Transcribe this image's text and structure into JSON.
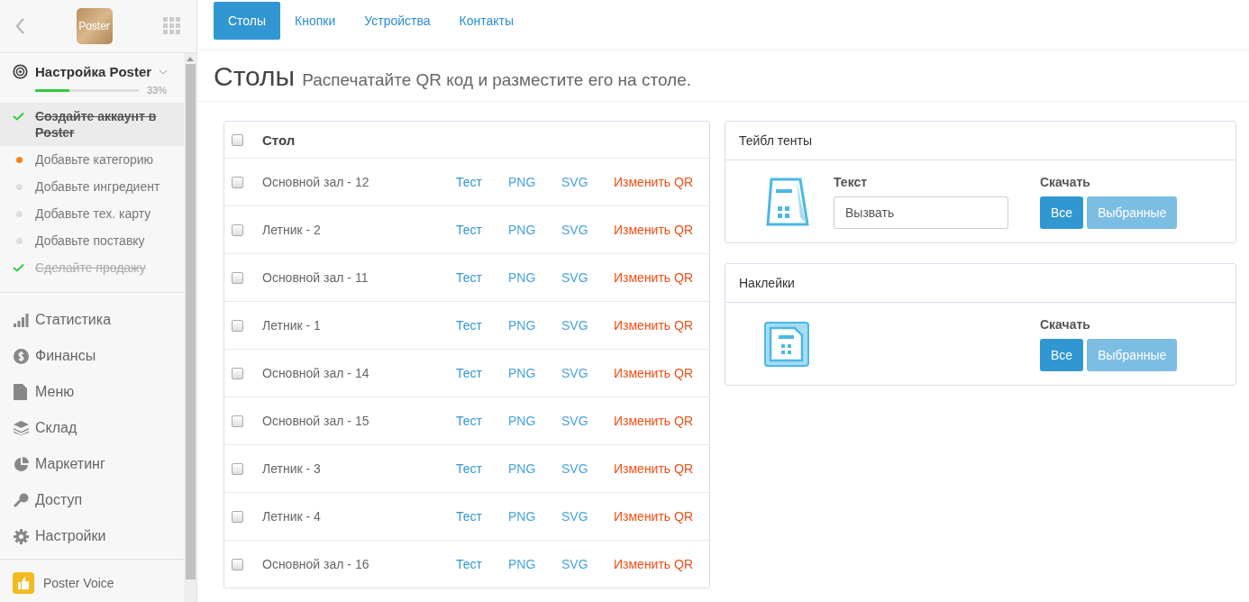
{
  "sidebar": {
    "logo_text": "Poster",
    "setup": {
      "title": "Настройка Poster",
      "level": 0.33,
      "percent": "33%",
      "steps": [
        {
          "label": "Создайте аккаунт в Poster",
          "done": true,
          "selected": true
        },
        {
          "label": "Добавьте категорию",
          "done": false,
          "current": true,
          "selected": false
        },
        {
          "label": "Добавьте ингредиент",
          "done": false,
          "current": false,
          "selected": false
        },
        {
          "label": "Добавьте тех. карту",
          "done": false,
          "current": false,
          "selected": false
        },
        {
          "label": "Добавьте поставку",
          "done": false,
          "current": false,
          "selected": false
        },
        {
          "label": "Сделайте продажу",
          "done": true,
          "selected": false
        }
      ]
    },
    "items": [
      {
        "label": "Статистика",
        "kind": "stats"
      },
      {
        "label": "Финансы",
        "kind": "finance"
      },
      {
        "label": "Меню",
        "kind": "menu"
      },
      {
        "label": "Склад",
        "kind": "stock"
      },
      {
        "label": "Маркетинг",
        "kind": "marketing"
      },
      {
        "label": "Доступ",
        "kind": "access"
      },
      {
        "label": "Настройки",
        "kind": "settings"
      }
    ],
    "voice": "Poster Voice"
  },
  "tabs": [
    {
      "label": "Столы",
      "selected": true
    },
    {
      "label": "Кнопки",
      "selected": false
    },
    {
      "label": "Устройства",
      "selected": false
    },
    {
      "label": "Контакты",
      "selected": false
    }
  ],
  "header": {
    "title": "Столы",
    "subtitle": "Распечатайте QR код и разместите его на столе."
  },
  "table": {
    "column": "Стол",
    "checked_all": false,
    "rows": [
      {
        "name": "Основной зал - 12",
        "checked": false,
        "links": [
          "Тест",
          "PNG",
          "SVG"
        ],
        "edit": "Изменить QR"
      },
      {
        "name": "Летник - 2",
        "checked": false,
        "links": [
          "Тест",
          "PNG",
          "SVG"
        ],
        "edit": "Изменить QR"
      },
      {
        "name": "Основной зал - 11",
        "checked": false,
        "links": [
          "Тест",
          "PNG",
          "SVG"
        ],
        "edit": "Изменить QR"
      },
      {
        "name": "Летник - 1",
        "checked": false,
        "links": [
          "Тест",
          "PNG",
          "SVG"
        ],
        "edit": "Изменить QR"
      },
      {
        "name": "Основной зал - 14",
        "checked": false,
        "links": [
          "Тест",
          "PNG",
          "SVG"
        ],
        "edit": "Изменить QR"
      },
      {
        "name": "Основной зал - 15",
        "checked": false,
        "links": [
          "Тест",
          "PNG",
          "SVG"
        ],
        "edit": "Изменить QR"
      },
      {
        "name": "Летник - 3",
        "checked": false,
        "links": [
          "Тест",
          "PNG",
          "SVG"
        ],
        "edit": "Изменить QR"
      },
      {
        "name": "Летник - 4",
        "checked": false,
        "links": [
          "Тест",
          "PNG",
          "SVG"
        ],
        "edit": "Изменить QR"
      },
      {
        "name": "Основной зал - 16",
        "checked": false,
        "links": [
          "Тест",
          "PNG",
          "SVG"
        ],
        "edit": "Изменить QR"
      }
    ]
  },
  "cards": [
    {
      "title": "Тейбл тенты",
      "kind": "tent",
      "field_label": "Текст",
      "field_value": "Вызвать",
      "download_label": "Скачать",
      "buttons": [
        "Все",
        "Выбранные"
      ]
    },
    {
      "title": "Наклейки",
      "kind": "sticker",
      "download_label": "Скачать",
      "buttons": [
        "Все",
        "Выбранные"
      ]
    }
  ]
}
